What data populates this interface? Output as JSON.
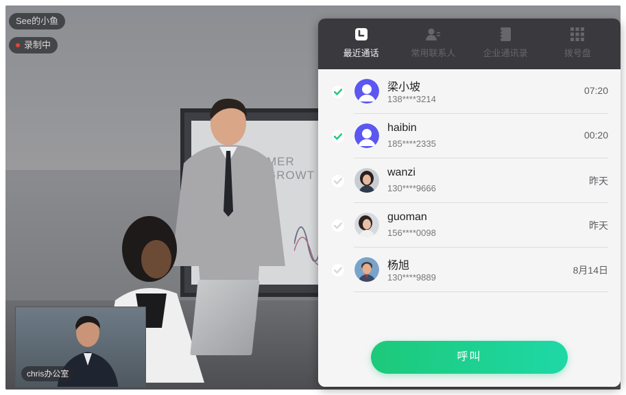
{
  "stage": {
    "room_name": "See的小鱼",
    "recording_label": "录制中",
    "screen_text": "MER GROWT",
    "self_view_label": "chris办公室"
  },
  "panel": {
    "tabs": [
      {
        "label": "最近通话",
        "icon": "recent-calls-icon",
        "active": true
      },
      {
        "label": "常用联系人",
        "icon": "contacts-icon",
        "active": false
      },
      {
        "label": "企业通讯录",
        "icon": "directory-icon",
        "active": false
      },
      {
        "label": "拨号盘",
        "icon": "dialpad-icon",
        "active": false
      }
    ],
    "calls": [
      {
        "name": "梁小坡",
        "phone": "138****3214",
        "time": "07:20",
        "checked": true,
        "avatar": "default-avatar-icon"
      },
      {
        "name": "haibin",
        "phone": "185****2335",
        "time": "00:20",
        "checked": true,
        "avatar": "default-avatar-icon"
      },
      {
        "name": "wanzi",
        "phone": "130****9666",
        "time": "昨天",
        "checked": false,
        "avatar": "photo"
      },
      {
        "name": "guoman",
        "phone": "156****0098",
        "time": "昨天",
        "checked": false,
        "avatar": "photo"
      },
      {
        "name": "杨旭",
        "phone": "130****9889",
        "time": "8月14日",
        "checked": false,
        "avatar": "photo"
      }
    ],
    "call_button_label": "呼叫"
  },
  "colors": {
    "accent_green": "#1dc97a",
    "accent_teal": "#1ed8a6",
    "default_avatar": "#5b57f0",
    "tab_bar": "#3a3a3e",
    "panel_bg": "#ededed"
  }
}
